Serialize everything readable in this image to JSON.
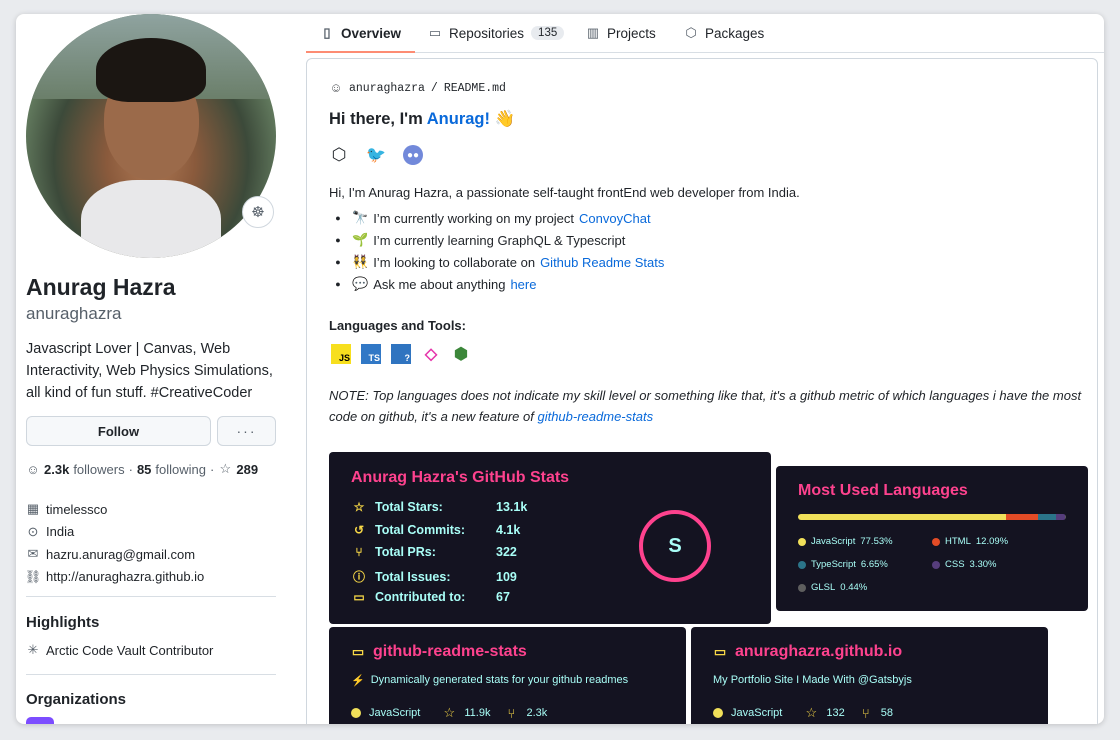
{
  "profile": {
    "fullname": "Anurag Hazra",
    "username": "anuraghazra",
    "bio": "Javascript Lover | Canvas, Web Interactivity, Web Physics Simulations, all kind of fun stuff. #CreativeCoder",
    "follow_label": "Follow",
    "more_label": "···",
    "followers": "2.3k",
    "followers_label": "followers",
    "following": "85",
    "following_label": "following",
    "stars": "289",
    "company": "timelessco",
    "location": "India",
    "email": "hazru.anurag@gmail.com",
    "website": "http://anuraghazra.github.io",
    "highlights_title": "Highlights",
    "highlight": "Arctic Code Vault Contributor",
    "organizations_title": "Organizations"
  },
  "tabs": [
    {
      "label": "Overview",
      "icon": "book-icon"
    },
    {
      "label": "Repositories",
      "count": "135",
      "icon": "repo-icon"
    },
    {
      "label": "Projects",
      "icon": "project-icon"
    },
    {
      "label": "Packages",
      "icon": "package-icon"
    }
  ],
  "readme": {
    "owner": "anuraghazra",
    "sep": "/",
    "file": "README.md",
    "greeting": "Hi there, I'm",
    "greeting_name": "Anurag!",
    "greeting_emoji": "👋",
    "intro": "Hi, I'm Anurag Hazra, a passionate self-taught frontEnd web developer from India.",
    "bullets": [
      {
        "emoji": "🔭",
        "text": "I’m currently working on my project",
        "link": "ConvoyChat"
      },
      {
        "emoji": "🌱",
        "text": "I’m currently learning GraphQL & Typescript",
        "link": ""
      },
      {
        "emoji": "👯",
        "text": "I’m looking to collaborate on",
        "link": "Github Readme Stats"
      },
      {
        "emoji": "💬",
        "text": "Ask me about anything",
        "link": "here"
      }
    ],
    "languages_title": "Languages and Tools:",
    "tools": [
      {
        "label": "JS",
        "bg": "#f7df1e",
        "fg": "#000000"
      },
      {
        "label": "TS",
        "bg": "#3178c6",
        "fg": "#ffffff"
      },
      {
        "label": "?",
        "bg": "#2f74c0",
        "fg": "#ffffff"
      },
      {
        "label": "◇",
        "bg": "#ffffff",
        "fg": "#e535ab"
      },
      {
        "label": "⬢",
        "bg": "#ffffff",
        "fg": "#3c873a"
      }
    ],
    "note": "NOTE: Top languages does not indicate my skill level or something like that, it's a github metric of which languages i have the most code on github, it's a new feature of",
    "note_link": "github-readme-stats"
  },
  "stats_card": {
    "title": "Anurag Hazra's GitHub Stats",
    "rows": [
      {
        "label": "Total Stars:",
        "value": "13.1k",
        "icon": "star-icon"
      },
      {
        "label": "Total Commits:",
        "value": "4.1k",
        "icon": "history-icon"
      },
      {
        "label": "Total PRs:",
        "value": "322",
        "icon": "pull-request-icon"
      },
      {
        "label": "Total Issues:",
        "value": "109",
        "icon": "issue-icon"
      },
      {
        "label": "Contributed to:",
        "value": "67",
        "icon": "repo-icon"
      }
    ],
    "rank": "S"
  },
  "languages_card": {
    "title": "Most Used Languages",
    "items": [
      {
        "name": "JavaScript",
        "percent": "77.53%",
        "value": 77.53,
        "color": "#f1e05a"
      },
      {
        "name": "HTML",
        "percent": "12.09%",
        "value": 12.09,
        "color": "#e34c26"
      },
      {
        "name": "TypeScript",
        "percent": "6.65%",
        "value": 6.65,
        "color": "#2b7489"
      },
      {
        "name": "CSS",
        "percent": "3.30%",
        "value": 3.3,
        "color": "#563d7c"
      },
      {
        "name": "GLSL",
        "percent": "0.44%",
        "value": 0.44,
        "color": "#5e5e5e"
      }
    ]
  },
  "repo_cards": [
    {
      "name": "github-readme-stats",
      "desc_emoji": "⚡",
      "desc": "Dynamically generated stats for your github readmes",
      "language": "JavaScript",
      "lang_color": "#f1e05a",
      "stars": "11.9k",
      "forks": "2.3k"
    },
    {
      "name": "anuraghazra.github.io",
      "desc_emoji": "",
      "desc": "My Portfolio Site I Made With @Gatsbyjs",
      "language": "JavaScript",
      "lang_color": "#f1e05a",
      "stars": "132",
      "forks": "58"
    }
  ],
  "colors": {
    "accent": "#fe428e",
    "card_bg": "#141321",
    "card_text": "#a9fef7",
    "link": "#0969da"
  }
}
